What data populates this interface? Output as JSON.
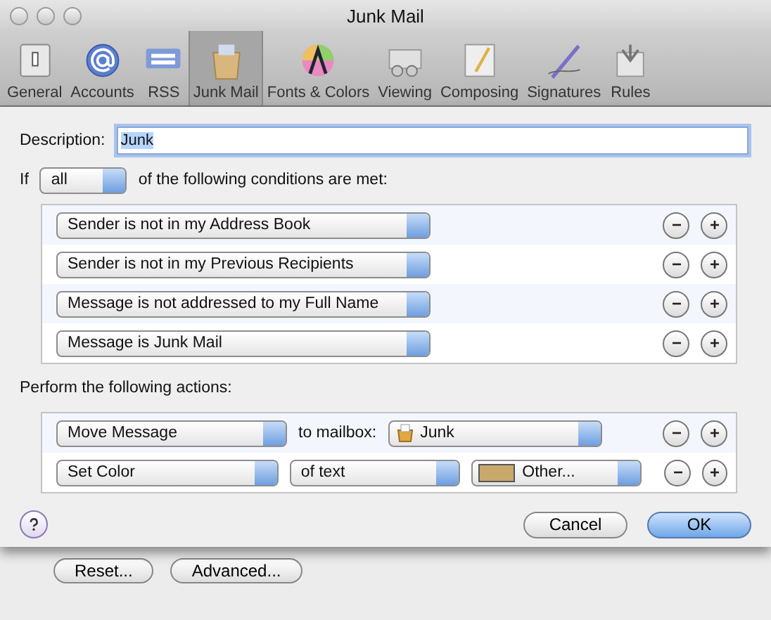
{
  "window": {
    "title": "Junk Mail"
  },
  "toolbar": [
    {
      "label": "General",
      "selected": false
    },
    {
      "label": "Accounts",
      "selected": false
    },
    {
      "label": "RSS",
      "selected": false
    },
    {
      "label": "Junk Mail",
      "selected": true
    },
    {
      "label": "Fonts & Colors",
      "selected": false
    },
    {
      "label": "Viewing",
      "selected": false
    },
    {
      "label": "Composing",
      "selected": false
    },
    {
      "label": "Signatures",
      "selected": false
    },
    {
      "label": "Rules",
      "selected": false
    }
  ],
  "description": {
    "label": "Description:",
    "value": "Junk"
  },
  "match": {
    "prefix": "If",
    "selector": "all",
    "suffix": "of the following conditions are met:"
  },
  "conditions": [
    {
      "criterion": "Sender is not in my Address Book"
    },
    {
      "criterion": "Sender is not in my Previous Recipients"
    },
    {
      "criterion": "Message is not addressed to my Full Name"
    },
    {
      "criterion": "Message is Junk Mail"
    }
  ],
  "actions_label": "Perform the following actions:",
  "actions": [
    {
      "kind": "move",
      "action": "Move Message",
      "connector": "to mailbox:",
      "mailbox": "Junk"
    },
    {
      "kind": "color",
      "action": "Set Color",
      "target": "of text",
      "color_label": "Other...",
      "color": "#c8a86b"
    }
  ],
  "buttons": [
    {
      "label": "Cancel",
      "default": false
    },
    {
      "label": "OK",
      "default": true
    }
  ],
  "background_buttons": [
    "Reset...",
    "Advanced..."
  ]
}
